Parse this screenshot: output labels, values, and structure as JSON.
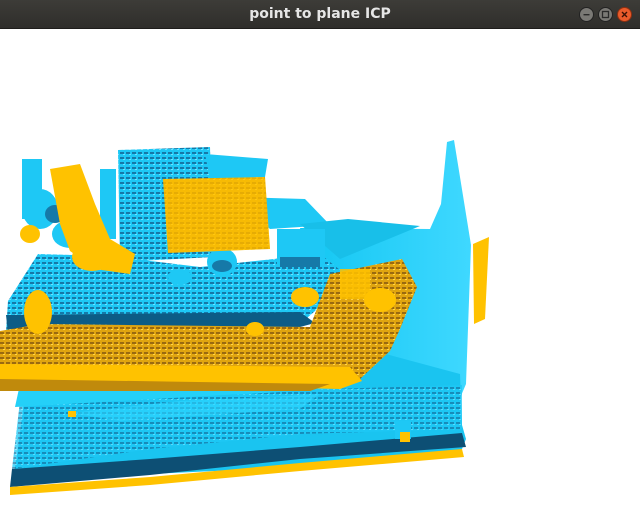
{
  "window": {
    "title": "point to plane ICP",
    "controls": [
      "minimize",
      "maximize",
      "close"
    ]
  },
  "scene": {
    "source_cloud_color": "#ffc200",
    "target_cloud_color": "#1ec8f5",
    "background_color": "#ffffff"
  }
}
